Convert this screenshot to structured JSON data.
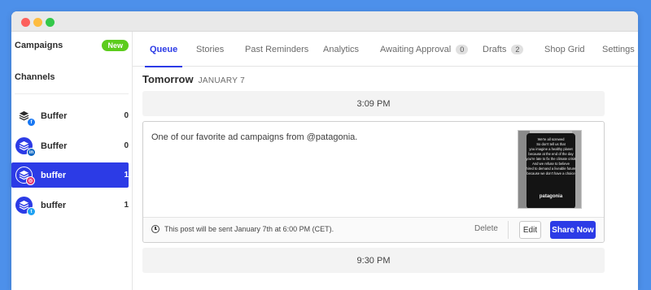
{
  "window": {
    "controls": [
      "close",
      "minimize",
      "maximize"
    ]
  },
  "sidebar": {
    "campaigns_label": "Campaigns",
    "campaigns_badge": "New",
    "channels_label": "Channels",
    "channels": [
      {
        "name": "Buffer",
        "count": "0",
        "network": "facebook-icon",
        "active": false
      },
      {
        "name": "Buffer",
        "count": "0",
        "network": "linkedin-icon",
        "active": false
      },
      {
        "name": "buffer",
        "count": "1",
        "network": "instagram-icon",
        "active": true
      },
      {
        "name": "buffer",
        "count": "1",
        "network": "twitter-icon",
        "active": false
      }
    ]
  },
  "tabs": [
    {
      "label": "Queue",
      "active": true
    },
    {
      "label": "Stories"
    },
    {
      "label": "Past Reminders"
    },
    {
      "label": "Analytics"
    },
    {
      "label": "Awaiting Approval",
      "count": "0"
    },
    {
      "label": "Drafts",
      "count": "2"
    },
    {
      "label": "Shop Grid"
    },
    {
      "label": "Settings"
    }
  ],
  "queue": {
    "day_label": "Tomorrow",
    "date_label": "JANUARY 7",
    "slots": [
      "3:09 PM",
      "9:30 PM"
    ],
    "post": {
      "text": "One of our favorite ad campaigns from @patagonia.",
      "image_lines": [
        "We're all screwed",
        "So don't tell us that",
        "you imagine a healthy planet",
        "because at the end of the day",
        "you're late to fix the climate crisis",
        "And we refuse to believe",
        "hired to demand a liveable future",
        "because we don't have a choice"
      ],
      "image_brand": "patagonia",
      "schedule_info": "This post will be sent January 7th at 6:00 PM (CET).",
      "delete_label": "Delete",
      "edit_label": "Edit",
      "share_label": "Share Now"
    }
  },
  "colors": {
    "accent": "#2c3be6",
    "background": "#4d90ea",
    "badge_new": "#5ccc1d"
  }
}
